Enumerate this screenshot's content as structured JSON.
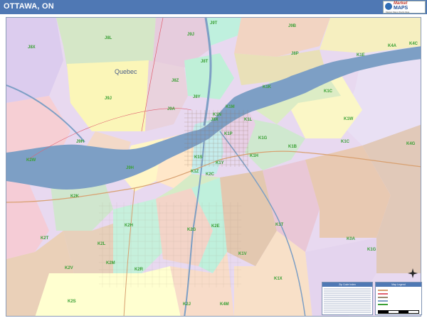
{
  "header": {
    "title": "OTTAWA, ON"
  },
  "logo": {
    "line1": "Market",
    "line2": "MAPS",
    "tagline": "Market Maps World Atlas"
  },
  "map": {
    "region_label": "Quebec",
    "zip_labels": {
      "j9t": "J9T",
      "j9b": "J9B",
      "j8x": "J8X",
      "j8l": "J8L",
      "j8t": "J8T",
      "j9j": "J9J",
      "j8r": "J8R",
      "j8z": "J8Z",
      "j8y": "J8Y",
      "j8m": "J8M",
      "j8p": "J8P",
      "j9a": "J9A",
      "j9h": "J9H",
      "j8v": "J8V",
      "k1w": "K1W",
      "k4a": "K4A",
      "k4c": "K4C",
      "k1e": "K1E",
      "k1c": "K1C",
      "k1b": "K1B",
      "k1j": "K1J",
      "k1k": "K1K",
      "k1l": "K1L",
      "k1m": "K1M",
      "k1n": "K1N",
      "k1p": "K1P",
      "k1r": "K1R",
      "k1s": "K1S",
      "k1y": "K1Y",
      "k1z": "K1Z",
      "k2a": "K2A",
      "k2b": "K2B",
      "k1g": "K1G",
      "k1h": "K1H",
      "k1t": "K1T",
      "k1v": "K1V",
      "k1x": "K1X",
      "k0a": "K0A",
      "k1a": "K1A",
      "k2w": "K2W",
      "k2k": "K2K",
      "k2h": "K2H",
      "k2g": "K2G",
      "k2e": "K2E",
      "k2c": "K2C",
      "k2t": "K2T",
      "k2l": "K2L",
      "k2m": "K2M",
      "k2v": "K2V",
      "k2s": "K2S",
      "k2r": "K2R",
      "k2j": "K2J",
      "k4m": "K4M",
      "k4b": "K4B",
      "k1g2": "K1G",
      "k4g": "K4G"
    }
  },
  "legend": {
    "table_title": "Zip Code Index",
    "key_title": "Map Legend"
  },
  "colors": {
    "water": "#7d9fc5",
    "zip_label": "#3aa035",
    "title_bar": "#4f78b4"
  }
}
